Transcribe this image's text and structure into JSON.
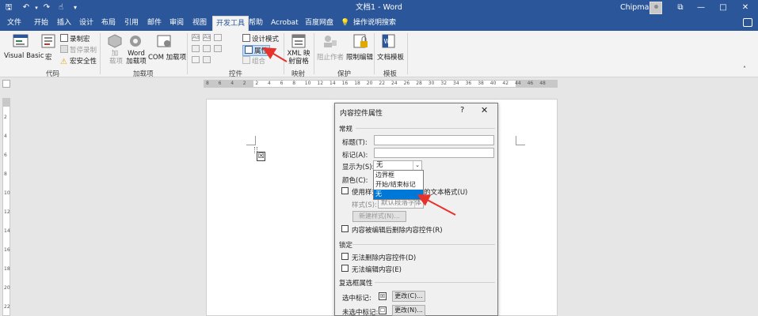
{
  "window": {
    "title": "文档1 - Word",
    "user": "Chipman",
    "accent_color": "#2b579a",
    "controls": {
      "minimize": "—",
      "maximize": "□",
      "close": "✕",
      "ribbon_options": "⧉"
    }
  },
  "quick_access": {
    "save_icon": "save-icon",
    "undo_icon": "undo-icon",
    "redo_icon": "redo-icon",
    "touch_icon": "touch-icon"
  },
  "tabs": [
    "文件",
    "开始",
    "插入",
    "设计",
    "布局",
    "引用",
    "邮件",
    "审阅",
    "视图",
    "开发工具",
    "帮助",
    "Acrobat",
    "百度网盘"
  ],
  "active_tab": "开发工具",
  "tell_me": "操作说明搜索",
  "ribbon": {
    "code": {
      "label": "代码",
      "visual_basic": "Visual Basic",
      "macros": "宏",
      "record_macro": "录制宏",
      "pause_recording": "暂停录制",
      "macro_security": "宏安全性"
    },
    "addins": {
      "label": "加载项",
      "addins_line1": "加",
      "addins_line2": "载项",
      "word_addins_line1": "Word",
      "word_addins_line2": "加载项",
      "com_addins": "COM 加载项"
    },
    "controls": {
      "label": "控件",
      "design_mode": "设计模式",
      "properties": "属性",
      "group": "组合"
    },
    "mapping": {
      "label": "映射",
      "xml_line1": "XML 映",
      "xml_line2": "射窗格"
    },
    "protect": {
      "label": "保护",
      "block_authors": "阻止作者",
      "restrict_editing": "限制编辑"
    },
    "templates": {
      "label": "模板",
      "document_template": "文档模板"
    }
  },
  "ruler": {
    "h_ticks": [
      "8",
      "6",
      "4",
      "2",
      "2",
      "4",
      "6",
      "8",
      "10",
      "12",
      "14",
      "16",
      "18",
      "20",
      "22",
      "24",
      "26",
      "28",
      "30",
      "32",
      "34",
      "36",
      "38",
      "40",
      "42",
      "44",
      "46",
      "48"
    ],
    "v_ticks": [
      "2",
      "4",
      "6",
      "8",
      "10",
      "12",
      "14",
      "16",
      "18",
      "20",
      "22"
    ]
  },
  "document": {
    "checkbox_symbol": "☒"
  },
  "dialog": {
    "title": "内容控件属性",
    "help": "?",
    "close": "✕",
    "general": {
      "section": "常规",
      "title_label": "标题(T):",
      "tag_label": "标记(A):",
      "show_as_label": "显示为(S):",
      "show_as_value": "无",
      "color_label": "颜色(C):",
      "use_style_label": "使用样式",
      "use_style_suffix": "的文本格式(U)",
      "style_label": "样式(S):",
      "style_value": "默认段落字体",
      "new_style": "新建样式(N)...",
      "remove_on_edit": "内容被编辑后删除内容控件(R)",
      "dropdown_options": [
        "边界框",
        "开始/结束标记",
        "无"
      ],
      "dropdown_selected": "无"
    },
    "locking": {
      "section": "锁定",
      "cannot_delete": "无法删除内容控件(D)",
      "cannot_edit": "无法编辑内容(E)"
    },
    "checkbox_props": {
      "section": "复选框属性",
      "checked_label": "选中标记:",
      "checked_symbol": "☒",
      "checked_change": "更改(C)...",
      "unchecked_label": "未选中标记:",
      "unchecked_symbol": "☐",
      "unchecked_change": "更改(N)..."
    },
    "highlight_color": "#0078d7"
  },
  "annotation_color": "#e8312a"
}
